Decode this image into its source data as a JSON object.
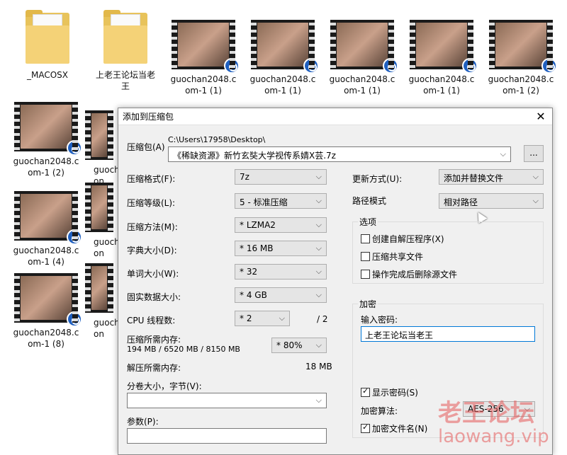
{
  "desktop": {
    "icons": [
      {
        "name": "_MACOSX",
        "kind": "folder"
      },
      {
        "name": "上老王论坛当老\n王",
        "kind": "folder"
      },
      {
        "name": "guochan2048.c\nom-1 (1)",
        "kind": "video"
      },
      {
        "name": "guochan2048.c\nom-1 (1)",
        "kind": "video"
      },
      {
        "name": "guochan2048.c\nom-1 (1)",
        "kind": "video"
      },
      {
        "name": "guochan2048.c\nom-1 (1)",
        "kind": "video"
      },
      {
        "name": "guochan2048.c\nom-1 (2)",
        "kind": "video"
      },
      {
        "name": "guochan2048.c\nom-1 (2)",
        "kind": "video"
      },
      {
        "name": "guochan2048.c\nom-1 (4)",
        "kind": "video"
      },
      {
        "name": "guochan2048.c\nom-1 (8)",
        "kind": "video"
      },
      {
        "name": "guoch\non",
        "kind": "video"
      },
      {
        "name": "guoch\non",
        "kind": "video"
      },
      {
        "name": "guoch\non",
        "kind": "video"
      }
    ]
  },
  "dialog": {
    "title": "添加到压缩包",
    "close": "✕",
    "archive_label": "压缩包(A)",
    "archive_path": "C:\\Users\\17958\\Desktop\\",
    "archive_name": "《稀缺资源》新竹玄奘大学视传系婧X芸.7z",
    "browse": "...",
    "format_label": "压缩格式(F):",
    "format_value": "7z",
    "level_label": "压缩等级(L):",
    "level_value": "5 - 标准压缩",
    "method_label": "压缩方法(M):",
    "method_value": "* LZMA2",
    "dict_label": "字典大小(D):",
    "dict_value": "* 16 MB",
    "word_label": "单词大小(W):",
    "word_value": "* 32",
    "solid_label": "固实数据大小:",
    "solid_value": "* 4 GB",
    "cpu_label": "CPU 线程数:",
    "cpu_value": "* 2",
    "cpu_total": "/ 2",
    "mem_label": "压缩所需内存:",
    "mem_detail": "194 MB / 6520 MB / 8150 MB",
    "mem_percent": "* 80%",
    "decomp_label": "解压所需内存:",
    "decomp_value": "18 MB",
    "split_label": "分卷大小，字节(V):",
    "split_value": "",
    "params_label": "参数(P):",
    "params_value": "",
    "update_label": "更新方式(U):",
    "update_value": "添加并替换文件",
    "path_label": "路径模式",
    "path_value": "相对路径",
    "options_title": "选项",
    "opt_sfx": "创建自解压程序(X)",
    "opt_shared": "压缩共享文件",
    "opt_delete": "操作完成后删除源文件",
    "encrypt_title": "加密",
    "password_label": "输入密码:",
    "password_value": "上老王论坛当老王",
    "show_password": "显示密码(S)",
    "enc_method_label": "加密算法:",
    "enc_method_value": "AES-256",
    "encrypt_names": "加密文件名(N)"
  },
  "watermark": {
    "line1": "老王论坛",
    "line2": "laowang.vip"
  }
}
